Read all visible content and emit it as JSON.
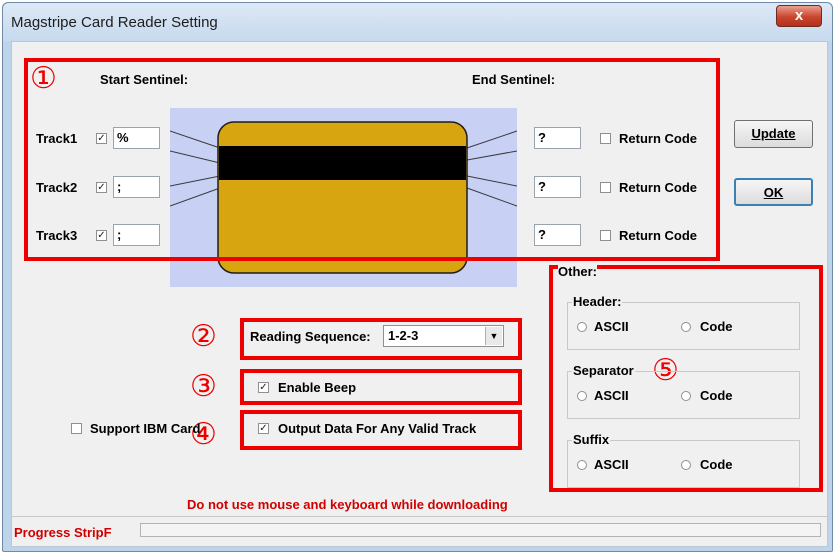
{
  "window": {
    "title": "Magstripe Card Reader Setting",
    "close_symbol": "x"
  },
  "headers": {
    "start_sentinel": "Start Sentinel:",
    "end_sentinel": "End Sentinel:"
  },
  "tracks": [
    {
      "label": "Track1",
      "checked": true,
      "start_value": "%",
      "end_value": "?",
      "return_code_label": "Return Code"
    },
    {
      "label": "Track2",
      "checked": true,
      "start_value": ";",
      "end_value": "?",
      "return_code_label": "Return Code"
    },
    {
      "label": "Track3",
      "checked": true,
      "start_value": ";",
      "end_value": "?",
      "return_code_label": "Return Code"
    }
  ],
  "buttons": {
    "update_label": "Update",
    "ok_label": "OK"
  },
  "reading_sequence": {
    "label": "Reading Sequence:",
    "value": "1-2-3",
    "arrow": "▼"
  },
  "options": {
    "enable_beep_label": "Enable Beep",
    "output_any_valid_label": "Output Data For Any Valid Track",
    "support_ibm_label": "Support IBM Card"
  },
  "other": {
    "title": "Other:",
    "header": {
      "title": "Header:",
      "ascii": "ASCII",
      "code": "Code"
    },
    "separator": {
      "title": "Separator",
      "ascii": "ASCII",
      "code": "Code"
    },
    "suffix": {
      "title": "Suffix",
      "ascii": "ASCII",
      "code": "Code"
    }
  },
  "warning": "Do not use mouse and keyboard while downloading",
  "progress": {
    "label": "Progress StripF",
    "value": 0
  },
  "annotations": {
    "n1": "①",
    "n2": "②",
    "n3": "③",
    "n4": "④",
    "n5": "⑤"
  },
  "colors": {
    "annotation_red": "#ee0000",
    "card_gold": "#d6a50f",
    "card_panel": "#c8d0f4",
    "warning_red": "#d10000"
  }
}
